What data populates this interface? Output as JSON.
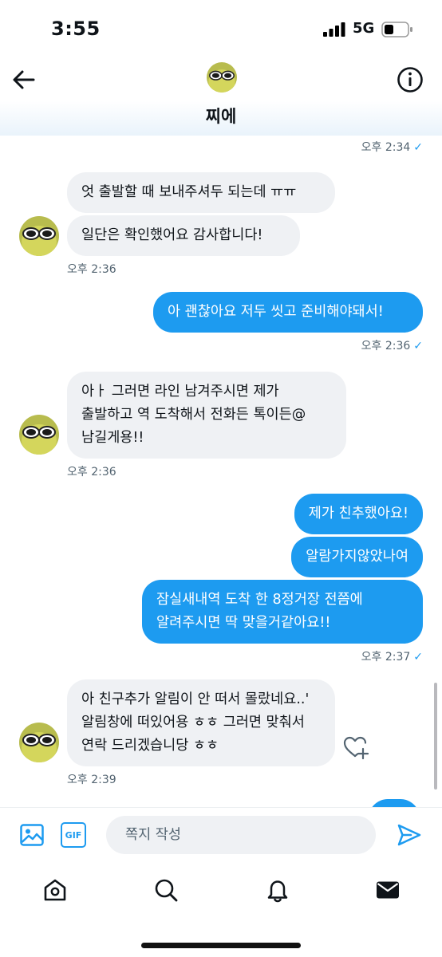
{
  "status_bar": {
    "time": "3:55",
    "network": "5G"
  },
  "header": {
    "contact_name": "찌에"
  },
  "messages": [
    {
      "id": "m0",
      "direction": "out",
      "text": "",
      "meta": "오후 2:34",
      "read": true
    },
    {
      "id": "m1",
      "direction": "in",
      "text": "엇 출발할 때 보내주셔두 되는데 ㅠㅠ"
    },
    {
      "id": "m2",
      "direction": "in",
      "text": "일단은 확인했어요 감사합니다!",
      "meta": "오후 2:36"
    },
    {
      "id": "m3",
      "direction": "out",
      "text": "아 괜찮아요 저두 씻고 준비해야돼서!",
      "meta": "오후 2:36",
      "read": true
    },
    {
      "id": "m4",
      "direction": "in",
      "text": "아ㅏ 그러면 라인 남겨주시면 제가 출발하고 역 도착해서 전화든 톡이든@남길게용!!",
      "meta": "오후 2:36"
    },
    {
      "id": "m5",
      "direction": "out",
      "text": "제가 친추했아요!"
    },
    {
      "id": "m6",
      "direction": "out",
      "text": "알람가지않았나여"
    },
    {
      "id": "m7",
      "direction": "out",
      "text": "잠실새내역 도착 한 8정거장 전쯤에 알려주시면 딱 맞을거같아요!!",
      "meta": "오후 2:37",
      "read": true
    },
    {
      "id": "m8",
      "direction": "in",
      "text": "아 친구추가 알림이 안 떠서 몰랐네요..' 알림창에 떠있어용 ㅎㅎ 그러면 맞춰서 연락 드리겠습니당 ㅎㅎ",
      "meta": "오후 2:39"
    }
  ],
  "composer": {
    "placeholder": "쪽지 작성"
  },
  "icons": {
    "back": "arrow-left-icon",
    "info": "info-icon",
    "image": "image-icon",
    "gif": "GIF",
    "send": "send-icon",
    "heart": "heart-plus-icon",
    "nav": [
      "home-icon",
      "search-icon",
      "bell-icon",
      "mail-icon"
    ]
  },
  "colors": {
    "accent": "#1d9bf0",
    "incoming_bubble": "#eff1f4",
    "meta_text": "#536471"
  }
}
